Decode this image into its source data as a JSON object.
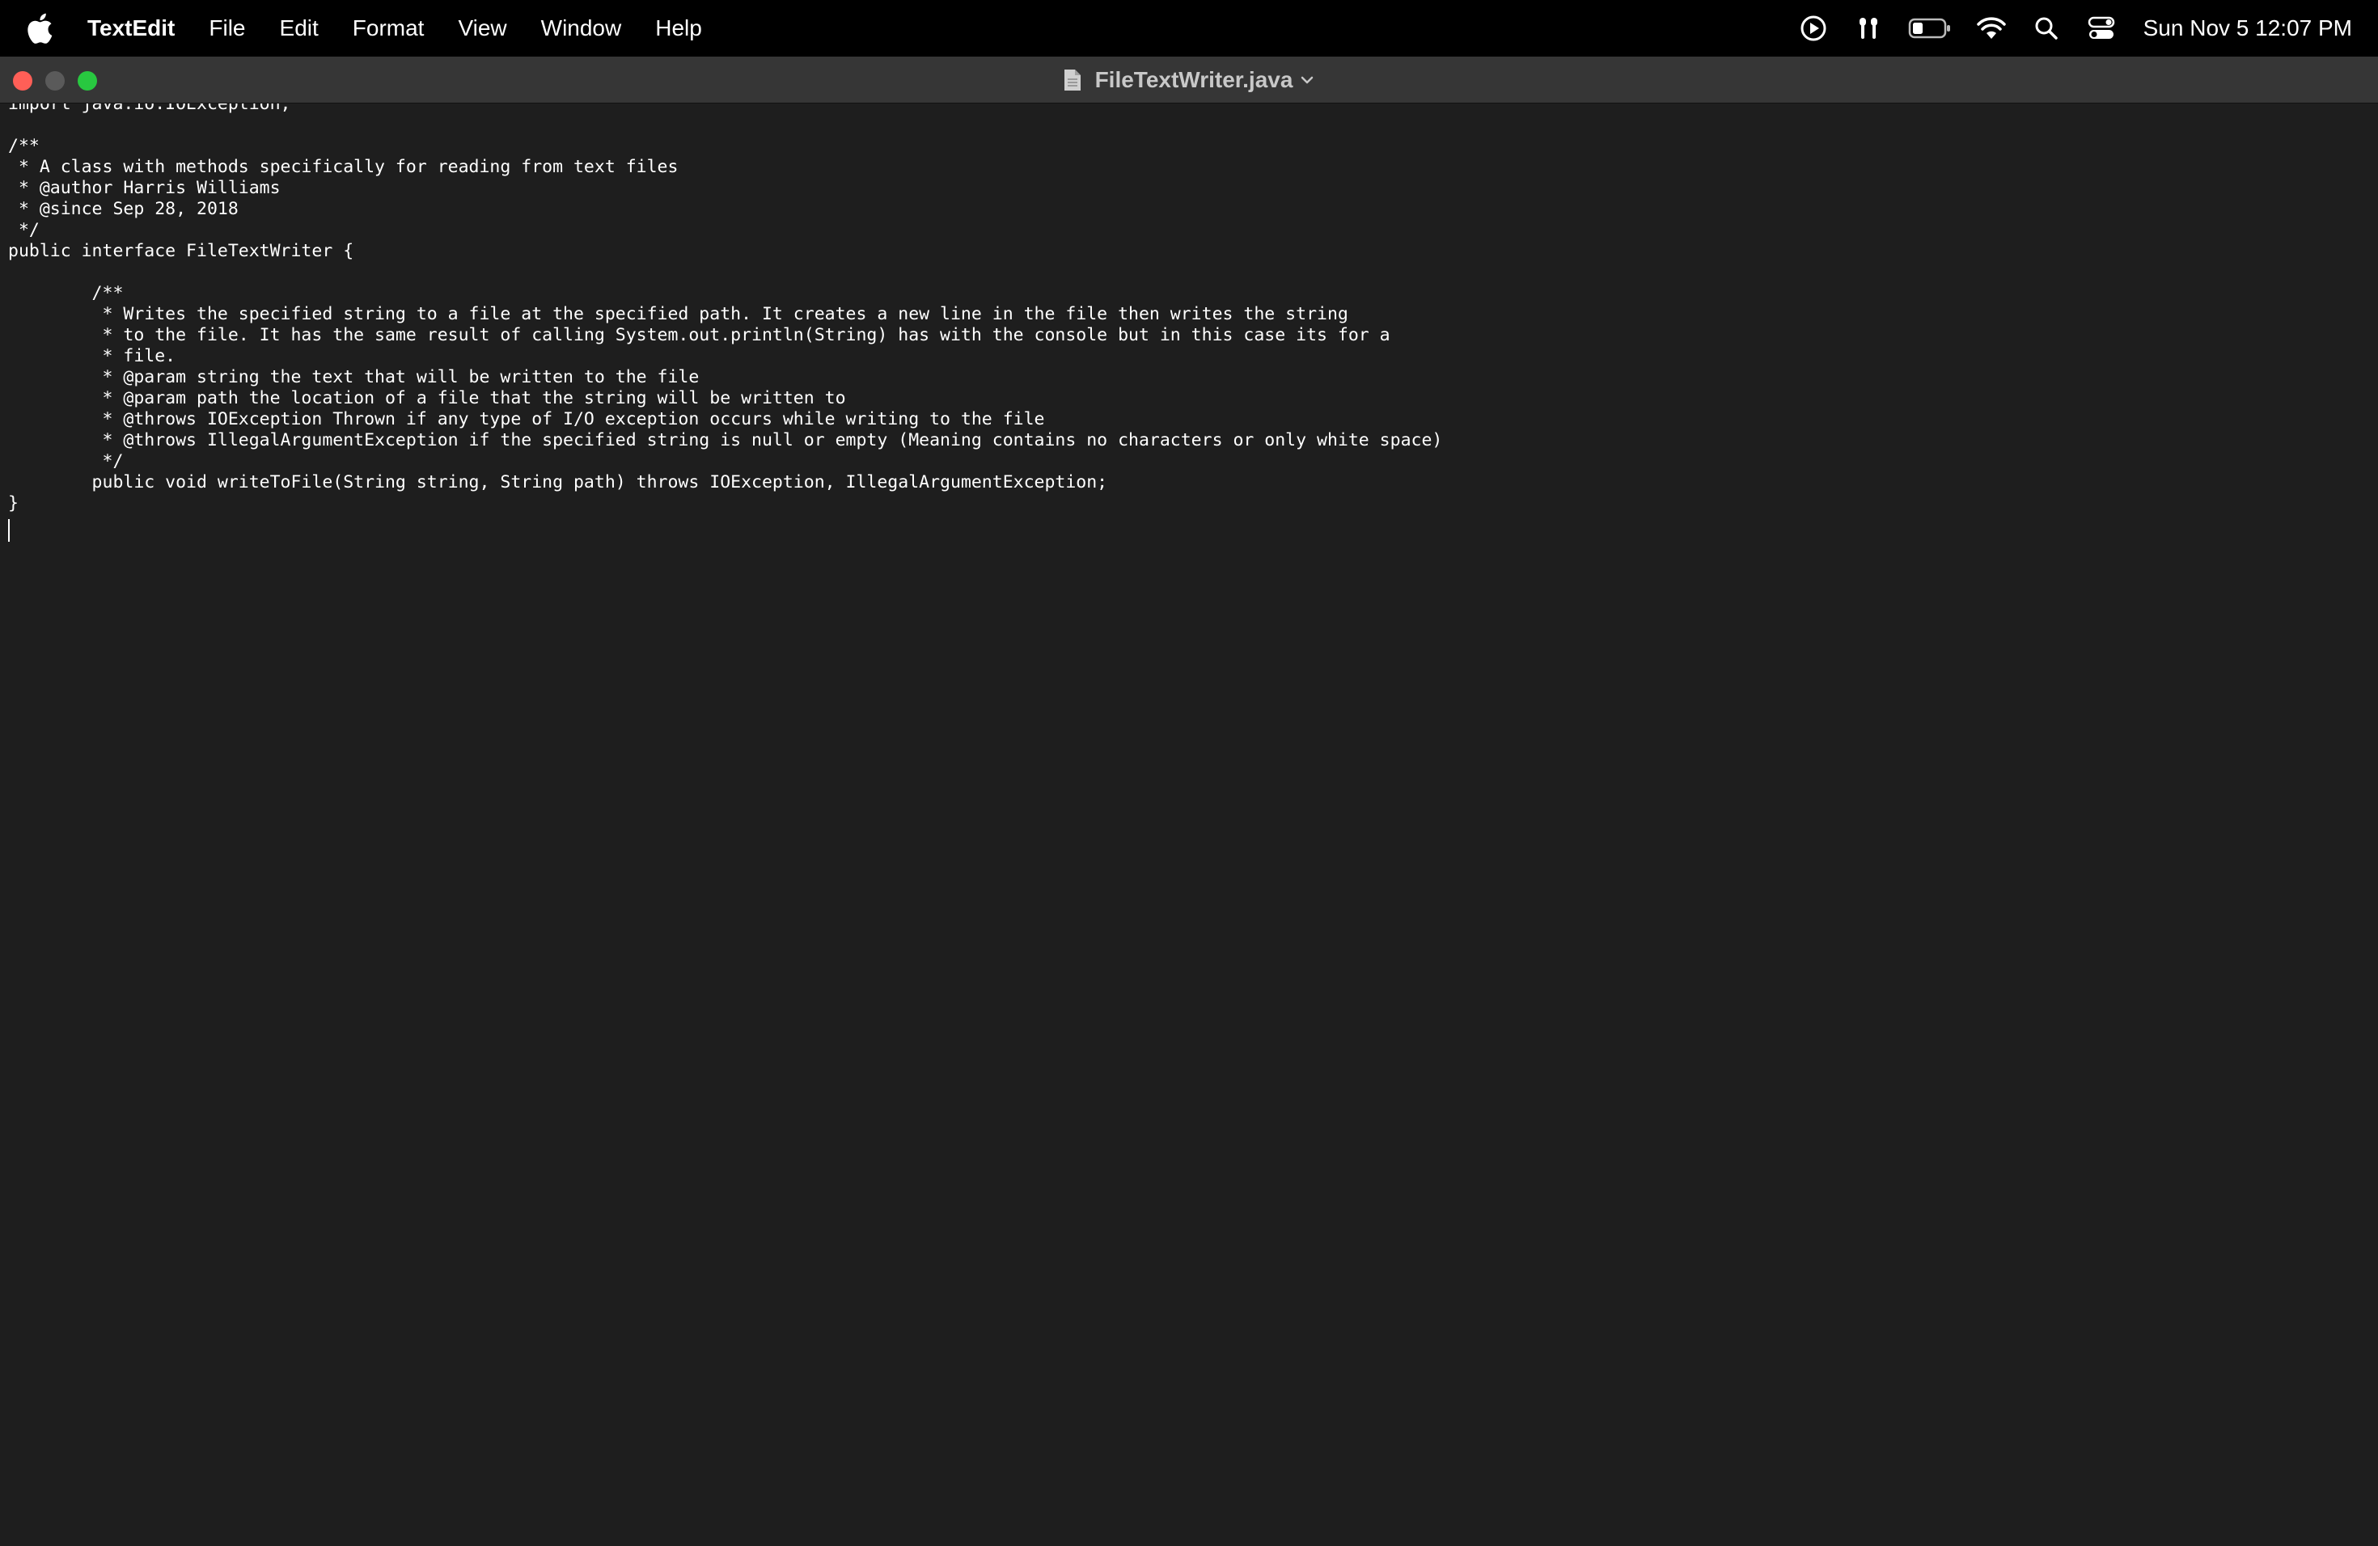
{
  "menubar": {
    "apple_icon": "apple-logo-icon",
    "items": [
      "TextEdit",
      "File",
      "Edit",
      "Format",
      "View",
      "Window",
      "Help"
    ],
    "status_icons": [
      "screen-recording-icon",
      "airpods-icon",
      "battery-icon",
      "wifi-icon",
      "spotlight-search-icon",
      "control-center-icon"
    ],
    "clock": "Sun Nov 5  12:07 PM"
  },
  "window": {
    "title": "FileTextWriter.java",
    "title_icon": "document-icon",
    "title_chevron": "chevron-down-icon"
  },
  "editor": {
    "lines": [
      "import java.io.IOException;",
      "",
      "/**",
      " * A class with methods specifically for reading from text files",
      " * @author Harris Williams",
      " * @since Sep 28, 2018",
      " */",
      "public interface FileTextWriter {",
      "",
      "        /**",
      "         * Writes the specified string to a file at the specified path. It creates a new line in the file then writes the string",
      "         * to the file. It has the same result of calling System.out.println(String) has with the console but in this case its for a",
      "         * file.",
      "         * @param string the text that will be written to the file",
      "         * @param path the location of a file that the string will be written to",
      "         * @throws IOException Thrown if any type of I/O exception occurs while writing to the file",
      "         * @throws IllegalArgumentException if the specified string is null or empty (Meaning contains no characters or only white space)",
      "         */",
      "        public void writeToFile(String string, String path) throws IOException, IllegalArgumentException;",
      "}",
      ""
    ]
  }
}
